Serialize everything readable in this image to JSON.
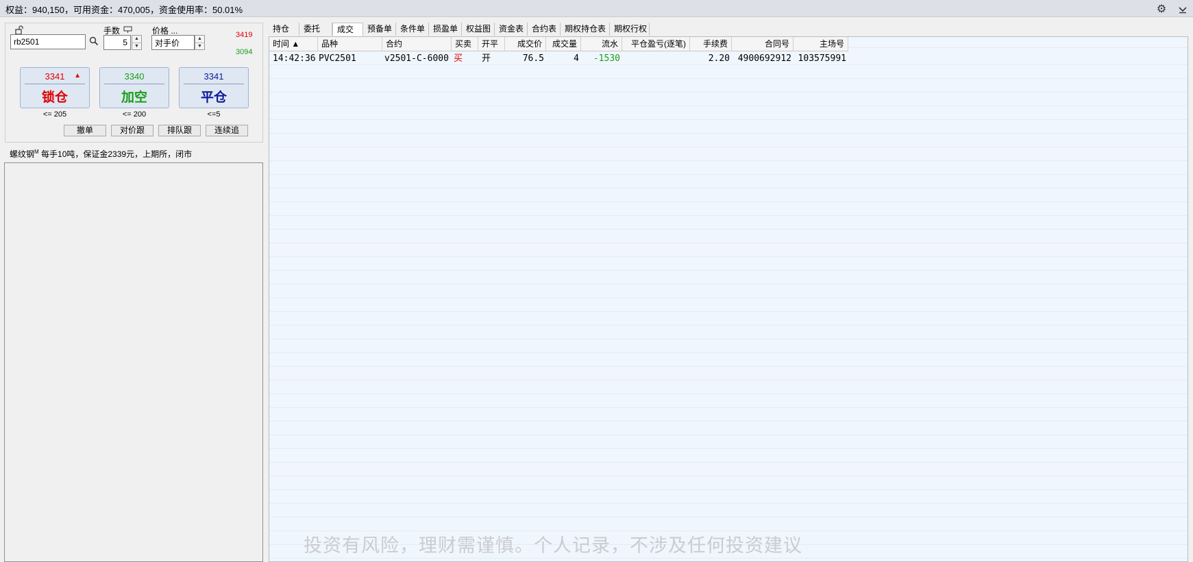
{
  "topbar": {
    "summary": "权益：940,150，可用资金：470,005，资金使用率：50.01%",
    "icons": [
      "gear-icon",
      "collapse-icon"
    ]
  },
  "order": {
    "contract_value": "rb2501",
    "qty_label": "手数",
    "qty_value": "5",
    "price_label": "价格 ...",
    "price_value": "对手价",
    "upper_limit": "3419",
    "lower_limit": "3094",
    "buttons": [
      {
        "price": "3341",
        "label": "锁仓",
        "limit": "<= 205",
        "color": "#e00000"
      },
      {
        "price": "3340",
        "label": "加空",
        "limit": "<= 200",
        "color": "#1a9e1a"
      },
      {
        "price": "3341",
        "label": "平仓",
        "limit": "<=5",
        "color": "#0a1a9a"
      }
    ],
    "small_buttons": [
      "撤单",
      "对价跟",
      "排队跟",
      "连续追"
    ],
    "contract_info": "螺纹钢",
    "contract_info_sup": "M",
    "contract_info_rest": " 每手10吨，保证金2339元，上期所，闭市"
  },
  "tabs": [
    "持仓",
    "委托",
    "成交",
    "预备单",
    "条件单",
    "损盈单",
    "权益图",
    "资金表",
    "合约表",
    "期权持仓表",
    "期权行权"
  ],
  "active_tab": "成交",
  "table": {
    "columns": [
      "时间 ▲",
      "品种",
      "合约",
      "买卖",
      "开平",
      "成交价",
      "成交量",
      "流水",
      "平仓盈亏(逐笔)",
      "手续费",
      "合同号",
      "主场号"
    ],
    "rows": [
      [
        "14:42:36",
        "PVC2501",
        "v2501-C-6000",
        "买",
        "开",
        "76.5",
        "4",
        "-1530",
        "",
        "2.20",
        "4900692912",
        "103575991"
      ]
    ]
  },
  "watermark": "投资有风险，理财需谨慎。个人记录，不涉及任何投资建议",
  "colors": {
    "buy": "#e00000",
    "negative": "#1a9e1a",
    "active_tab_bg": "#ffffff"
  }
}
